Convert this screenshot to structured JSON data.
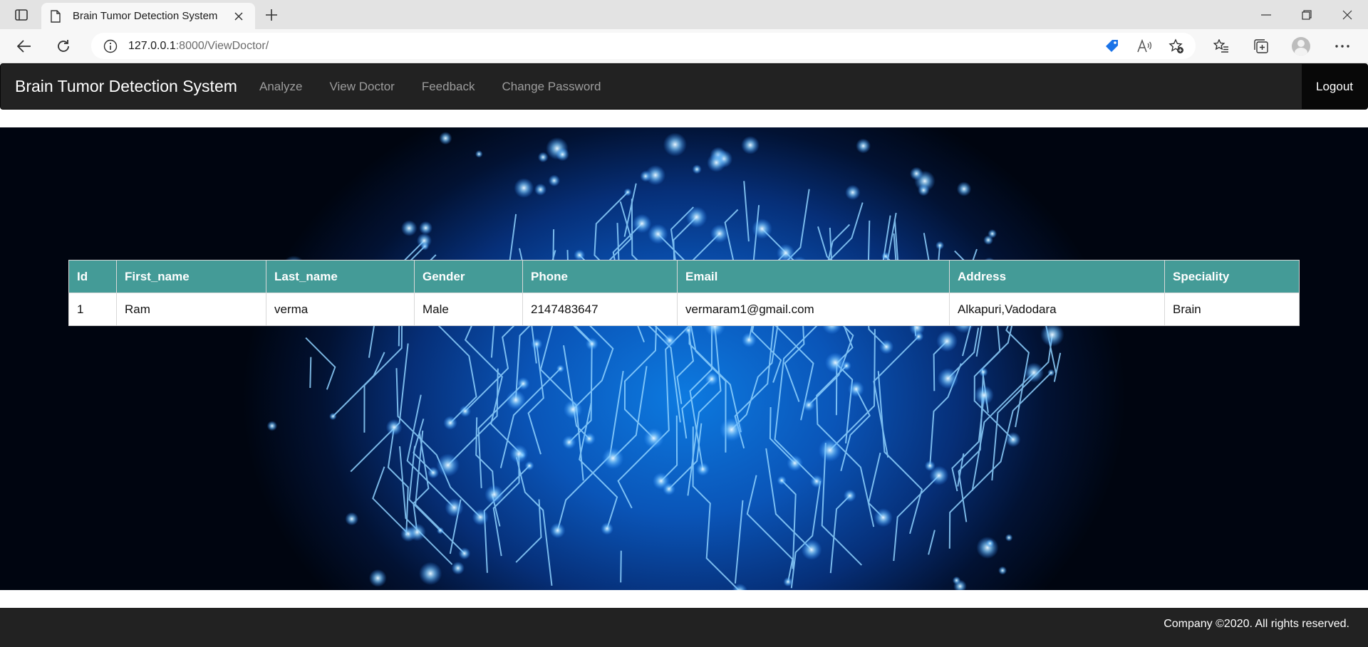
{
  "browser": {
    "tab_title": "Brain Tumor Detection System",
    "url_host": "127.0.0.1",
    "url_path": ":8000/ViewDoctor/"
  },
  "navbar": {
    "brand": "Brain Tumor Detection System",
    "links": [
      "Analyze",
      "View Doctor",
      "Feedback",
      "Change Password"
    ],
    "logout": "Logout"
  },
  "table": {
    "headers": [
      "Id",
      "First_name",
      "Last_name",
      "Gender",
      "Phone",
      "Email",
      "Address",
      "Speciality"
    ],
    "rows": [
      [
        "1",
        "Ram",
        "verma",
        "Male",
        "2147483647",
        "vermaram1@gmail.com",
        "Alkapuri,Vadodara",
        "Brain"
      ]
    ]
  },
  "footer": {
    "copyright": "Company ©2020. All rights reserved."
  },
  "colors": {
    "navbar_bg": "#222222",
    "table_header_bg": "#449b97",
    "hero_glow": "#0d7ae0"
  }
}
